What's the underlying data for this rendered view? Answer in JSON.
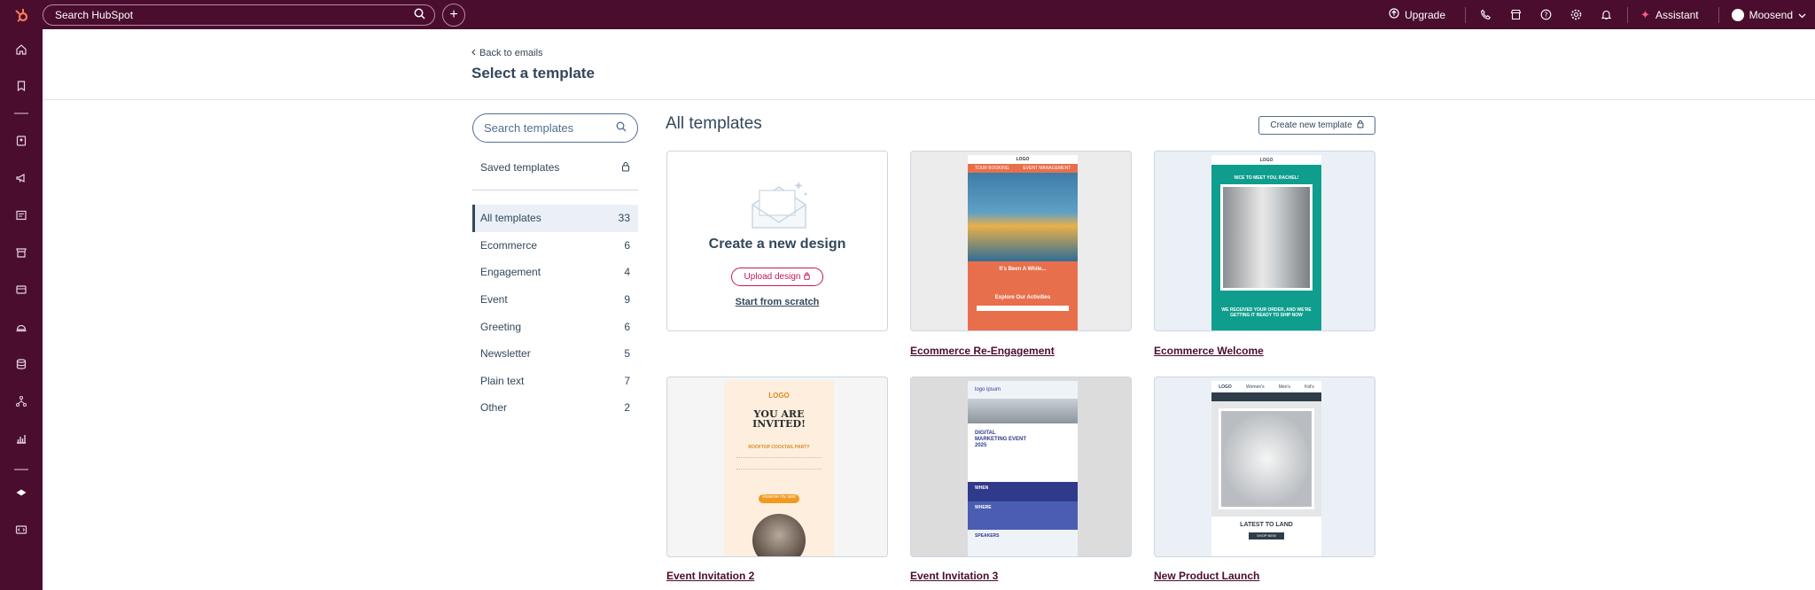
{
  "topbar": {
    "search_placeholder": "Search HubSpot",
    "upgrade_label": "Upgrade",
    "assistant_label": "Assistant",
    "account_label": "Moosend"
  },
  "header": {
    "back_link": "Back to emails",
    "title": "Select a template"
  },
  "filters": {
    "search_placeholder": "Search templates",
    "saved_label": "Saved templates",
    "categories": [
      {
        "label": "All templates",
        "count": "33"
      },
      {
        "label": "Ecommerce",
        "count": "6"
      },
      {
        "label": "Engagement",
        "count": "4"
      },
      {
        "label": "Event",
        "count": "9"
      },
      {
        "label": "Greeting",
        "count": "6"
      },
      {
        "label": "Newsletter",
        "count": "5"
      },
      {
        "label": "Plain text",
        "count": "7"
      },
      {
        "label": "Other",
        "count": "2"
      }
    ]
  },
  "main": {
    "title": "All templates",
    "create_button": "Create new template",
    "new_design": {
      "title": "Create a new design",
      "upload_label": "Upload design",
      "scratch_label": "Start from scratch"
    },
    "templates": [
      {
        "label": "Ecommerce Re-Engagement"
      },
      {
        "label": "Ecommerce Welcome"
      },
      {
        "label": "Event Invitation 2"
      },
      {
        "label": "Event Invitation 3"
      },
      {
        "label": "New Product Launch"
      }
    ],
    "previews": {
      "reengage": {
        "logo": "LOGO",
        "nav1": "TOUR BOOKING",
        "nav2": "EVENT MANAGEMENT",
        "headline": "It's Been A While...",
        "cta": "Explore Our Activities"
      },
      "welcome": {
        "logo": "LOGO",
        "headline": "NICE TO MEET YOU, RACHEL!",
        "body": "WE RECEIVED YOUR ORDER, AND WE'RE GETTING IT READY TO SHIP NOW"
      },
      "invite2": {
        "logo": "LOGO",
        "headline": "YOU ARE INVITED!",
        "sub": "ROOFTOP COCKTAIL PARTY",
        "cta": "Reserve my spot"
      },
      "invite3": {
        "logo": "logo ipsum",
        "headline": "DIGITAL MARKETING EVENT 2025",
        "when": "WHEN",
        "where": "WHERE",
        "speakers": "SPEAKERS"
      },
      "launch": {
        "logo": "LOGO",
        "nav1": "Women's",
        "nav2": "Men's",
        "nav3": "Kid's",
        "headline": "LATEST TO LAND",
        "cta": "SHOP NEW ARRIVALS"
      }
    }
  },
  "colors": {
    "brand_dark": "#4a0d2e",
    "accent_pink": "#c2185b",
    "text": "#33475b"
  }
}
